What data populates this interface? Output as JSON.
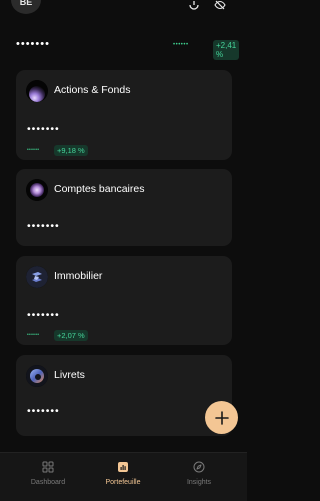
{
  "header": {
    "avatar_initials": "BE",
    "icons": [
      "privacy-filter-icon",
      "hide-values-icon"
    ]
  },
  "total": {
    "value_masked": "•••••••",
    "change_masked": "••••••",
    "change_percent": "+2,41 %"
  },
  "cards": [
    {
      "title": "Actions & Fonds",
      "value_masked": "•••••••",
      "perf_masked": "••••••",
      "perf_percent": "+9,18 %"
    },
    {
      "title": "Comptes bancaires",
      "value_masked": "•••••••"
    },
    {
      "title": "Immobilier",
      "value_masked": "•••••••",
      "perf_masked": "••••••",
      "perf_percent": "+2,07 %"
    },
    {
      "title": "Livrets",
      "value_masked": "•••••••"
    }
  ],
  "fab": {
    "icon": "plus-icon"
  },
  "tabs": [
    {
      "label": "Dashboard",
      "icon": "grid-icon",
      "active": false
    },
    {
      "label": "Portefeuille",
      "icon": "bar-chart-icon",
      "active": true
    },
    {
      "label": "Insights",
      "icon": "compass-icon",
      "active": false
    }
  ],
  "colors": {
    "background": "#0d0d0d",
    "card": "#1c1c1c",
    "accent": "#f3c694",
    "positive": "#46d49a",
    "positive_bg": "#16382b"
  }
}
